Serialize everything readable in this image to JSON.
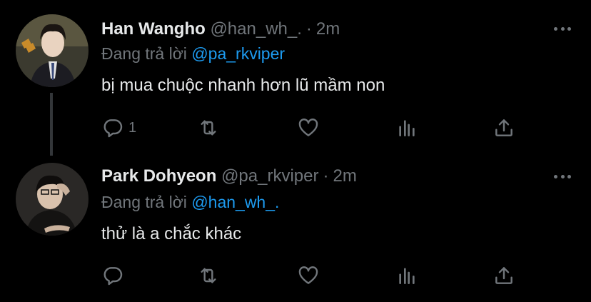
{
  "tweets": [
    {
      "name": "Han Wangho",
      "handle": "@han_wh_.",
      "dot": "·",
      "time": "2m",
      "reply_prefix": "Đang trả lời",
      "reply_to": "@pa_rkviper",
      "text": "bị mua chuộc nhanh hơn lũ mầm non",
      "reply_count": "1"
    },
    {
      "name": "Park Dohyeon",
      "handle": "@pa_rkviper",
      "dot": "·",
      "time": "2m",
      "reply_prefix": "Đang trả lời",
      "reply_to": "@han_wh_.",
      "text": "thử là a chắc khác",
      "reply_count": ""
    }
  ],
  "icons": {
    "reply": "reply-icon",
    "retweet": "retweet-icon",
    "like": "heart-icon",
    "analytics": "analytics-icon",
    "share": "share-icon",
    "more": "more-icon"
  },
  "colors": {
    "background": "#000000",
    "text": "#e7e9ea",
    "muted": "#71767b",
    "accent": "#1d9bf0"
  }
}
